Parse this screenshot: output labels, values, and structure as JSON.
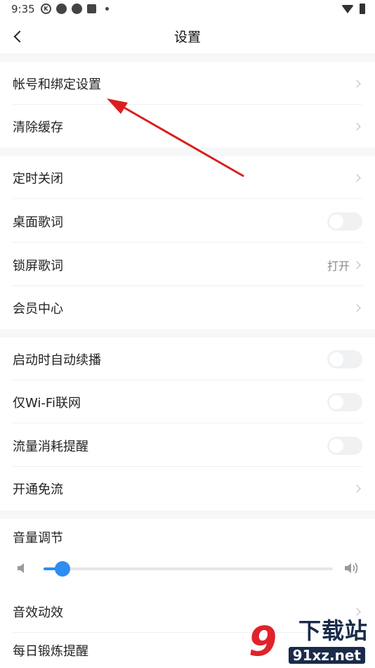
{
  "status_bar": {
    "time": "9:35",
    "icons": [
      "k-icon",
      "pinwheel-icon",
      "pinwheel-icon",
      "a-icon",
      "dot-icon"
    ],
    "right_icons": [
      "wifi-icon",
      "battery-icon"
    ]
  },
  "nav": {
    "title": "设置"
  },
  "groups": [
    {
      "rows": [
        {
          "label": "帐号和绑定设置",
          "control": "chevron"
        },
        {
          "label": "清除缓存",
          "control": "chevron"
        }
      ]
    },
    {
      "rows": [
        {
          "label": "定时关闭",
          "control": "chevron"
        },
        {
          "label": "桌面歌词",
          "control": "toggle",
          "on": false
        },
        {
          "label": "锁屏歌词",
          "control": "value",
          "value": "打开"
        },
        {
          "label": "会员中心",
          "control": "chevron"
        }
      ]
    },
    {
      "rows": [
        {
          "label": "启动时自动续播",
          "control": "toggle",
          "on": false
        },
        {
          "label": "仅Wi-Fi联网",
          "control": "toggle",
          "on": false
        },
        {
          "label": "流量消耗提醒",
          "control": "toggle",
          "on": false
        },
        {
          "label": "开通免流",
          "control": "chevron"
        }
      ]
    },
    {
      "rows": [
        {
          "label": "音量调节",
          "control": "none"
        },
        {
          "label": "音效动效",
          "control": "chevron"
        },
        {
          "label": "每日锻炼提醒",
          "control": "none"
        }
      ]
    }
  ],
  "volume": {
    "level": 0.065
  },
  "watermark": {
    "logo": "9",
    "top_text": "下载站",
    "bottom_text": "91xz.net"
  },
  "colors": {
    "accent": "#2e8df0",
    "annotation_arrow": "#d9201f",
    "band": "#f6f7f9"
  }
}
